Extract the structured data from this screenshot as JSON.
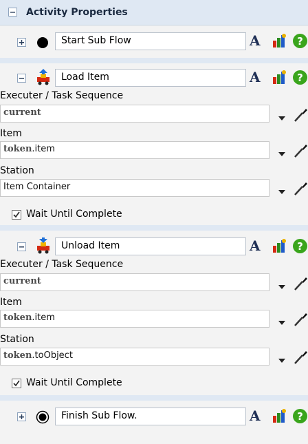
{
  "panel": {
    "title": "Activity Properties"
  },
  "activities": {
    "start": {
      "name": "Start Sub Flow"
    },
    "load": {
      "name": "Load Item",
      "executer_label": "Executer / Task Sequence",
      "executer_value": "current",
      "item_label": "Item",
      "item_kw": "token",
      "item_rest": ".item",
      "station_label": "Station",
      "station_value": "Item Container",
      "wait_label": "Wait Until Complete",
      "wait_checked": true
    },
    "unload": {
      "name": "Unload Item",
      "executer_label": "Executer / Task Sequence",
      "executer_value": "current",
      "item_label": "Item",
      "item_kw": "token",
      "item_rest": ".item",
      "station_label": "Station",
      "station_kw": "token",
      "station_rest": ".toObject",
      "wait_label": "Wait Until Complete",
      "wait_checked": true
    },
    "finish": {
      "name": "Finish Sub Flow."
    }
  },
  "icons": {
    "collapse": "minus-box-icon",
    "expand": "plus-box-icon",
    "font": "font-A-icon",
    "color": "color-picker-icon",
    "help": "help-icon",
    "dropdown": "chevron-down-icon",
    "sampler": "eyedropper-icon"
  },
  "colors": {
    "header_bg": "#dfe8f3",
    "help_green": "#3aa51c",
    "accent_red": "#d42a12"
  }
}
